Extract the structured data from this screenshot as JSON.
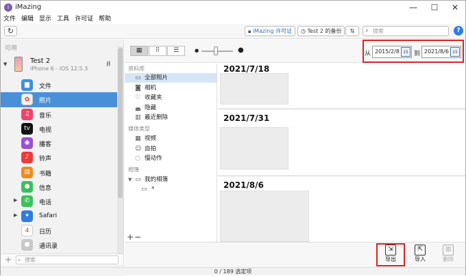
{
  "window": {
    "title": "iMazing",
    "app_icon": "imazing-logo-icon",
    "controls": [
      "minimize-icon",
      "maximize-icon",
      "close-icon"
    ]
  },
  "menu": [
    "文件",
    "编辑",
    "显示",
    "工具",
    "许可证",
    "帮助"
  ],
  "toolbar": {
    "refresh_icon": "refresh-icon",
    "license_brand": "iMazing",
    "license_suffix": " 许可证",
    "backup_label": "Test 2 的备份",
    "search_placeholder": "搜索",
    "help_label": "?"
  },
  "sidebar": {
    "section_label": "可用",
    "device": {
      "name": "Test 2",
      "subtitle": "iPhone 6 - iOS 12.5.3"
    },
    "items": [
      {
        "label": "文件",
        "icon": "folder-icon",
        "color": "#3d8fe0",
        "glyph": "▆",
        "expandable": false,
        "selected": false
      },
      {
        "label": "照片",
        "icon": "photos-icon",
        "color": "#f2f2f2",
        "glyph": "✿",
        "expandable": false,
        "selected": true
      },
      {
        "label": "音乐",
        "icon": "music-icon",
        "color": "#f2436a",
        "glyph": "♫",
        "expandable": false,
        "selected": false
      },
      {
        "label": "电视",
        "icon": "tv-icon",
        "color": "#111111",
        "glyph": "tv",
        "expandable": false,
        "selected": false
      },
      {
        "label": "播客",
        "icon": "podcasts-icon",
        "color": "#9a4fd6",
        "glyph": "◉",
        "expandable": false,
        "selected": false
      },
      {
        "label": "铃声",
        "icon": "ringtones-icon",
        "color": "#ee3b3b",
        "glyph": "♪",
        "expandable": false,
        "selected": false
      },
      {
        "label": "书籍",
        "icon": "books-icon",
        "color": "#f28a1c",
        "glyph": "▤",
        "expandable": false,
        "selected": false
      },
      {
        "label": "信息",
        "icon": "messages-icon",
        "color": "#3ac25a",
        "glyph": "●",
        "expandable": false,
        "selected": false
      },
      {
        "label": "电话",
        "icon": "phone-icon",
        "color": "#3ac25a",
        "glyph": "✆",
        "expandable": true,
        "selected": false
      },
      {
        "label": "Safari",
        "icon": "safari-icon",
        "color": "#2f7de1",
        "glyph": "✦",
        "expandable": true,
        "selected": false
      },
      {
        "label": "日历",
        "icon": "calendar-icon",
        "color": "#ffffff",
        "glyph": "4",
        "expandable": false,
        "selected": false
      },
      {
        "label": "通讯录",
        "icon": "contacts-icon",
        "color": "#c9c9c9",
        "glyph": "●",
        "expandable": false,
        "selected": false
      }
    ],
    "search_placeholder": "搜索"
  },
  "view": {
    "modes": [
      "grid-large-icon",
      "grid-small-icon",
      "list-icon"
    ],
    "zoom_level": 0.45,
    "range": {
      "from_label": "从",
      "from_value": "2015/2/8",
      "to_label": "到",
      "to_value": "2021/8/6",
      "calendar_text": "15"
    }
  },
  "albums": {
    "library_header": "资料库",
    "library": [
      {
        "label": "全部照片",
        "icon": "photos-library-icon",
        "glyph": "▭",
        "selected": true
      },
      {
        "label": "相机",
        "icon": "camera-icon",
        "glyph": "◙",
        "selected": false
      },
      {
        "label": "收藏夹",
        "icon": "heart-icon",
        "glyph": "♡",
        "selected": false
      },
      {
        "label": "隐藏",
        "icon": "hidden-icon",
        "glyph": "◛",
        "selected": false
      },
      {
        "label": "最近删除",
        "icon": "trash-icon",
        "glyph": "▥",
        "selected": false
      }
    ],
    "media_header": "媒体类型",
    "media": [
      {
        "label": "视频",
        "icon": "video-icon",
        "glyph": "▦"
      },
      {
        "label": "自拍",
        "icon": "selfie-icon",
        "glyph": "☺"
      },
      {
        "label": "慢动作",
        "icon": "slomo-icon",
        "glyph": "◌"
      }
    ],
    "albums_header": "相簿",
    "my_albums": "我的相簿",
    "sub_album_label": "*"
  },
  "photo_groups": [
    {
      "date": "2021/7/18"
    },
    {
      "date": "2021/7/31"
    },
    {
      "date": "2021/8/6"
    }
  ],
  "actions": {
    "export": "导出",
    "import": "导入",
    "delete": "删除"
  },
  "status": "0 / 189 选定项"
}
